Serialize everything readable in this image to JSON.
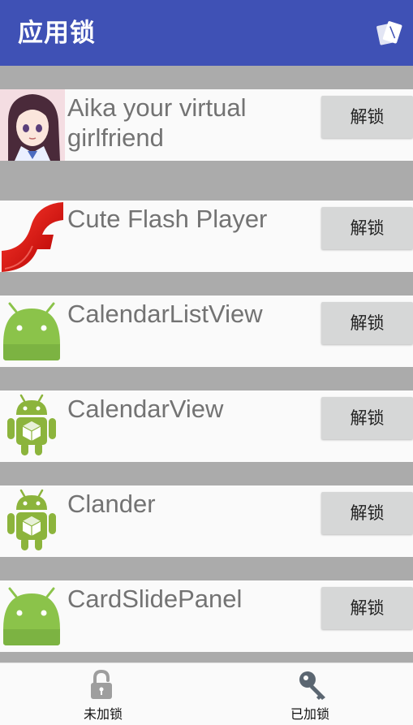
{
  "app_bar": {
    "title": "应用锁",
    "action_icon": "cards-icon",
    "color": "#3f51b5"
  },
  "apps": [
    {
      "name": "Aika your virtual girlfriend",
      "icon": "anime-girl-icon",
      "action_label": "解锁"
    },
    {
      "name": "Cute Flash Player",
      "icon": "flash-icon",
      "action_label": "解锁"
    },
    {
      "name": "CalendarListView",
      "icon": "android-head-icon",
      "action_label": "解锁"
    },
    {
      "name": "CalendarView",
      "icon": "android-robot-icon",
      "action_label": "解锁"
    },
    {
      "name": "Clander",
      "icon": "android-robot-icon",
      "action_label": "解锁"
    },
    {
      "name": "CardSlidePanel",
      "icon": "android-head-icon",
      "action_label": "解锁"
    }
  ],
  "bottom_nav": {
    "items": [
      {
        "label": "未加锁",
        "icon": "padlock-icon"
      },
      {
        "label": "已加锁",
        "icon": "key-icon"
      }
    ]
  }
}
